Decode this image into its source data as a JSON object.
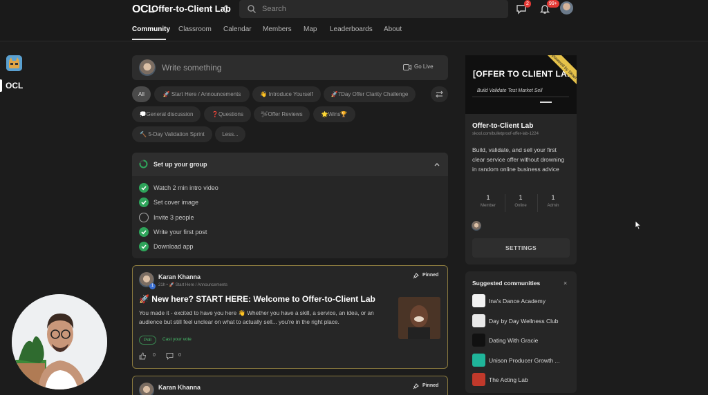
{
  "header": {
    "logo": "OCL",
    "group_name": "Offer-to-Client Lab",
    "search_placeholder": "Search",
    "chat_badge": "2",
    "notif_badge": "99+"
  },
  "nav": {
    "tabs": [
      "Community",
      "Classroom",
      "Calendar",
      "Members",
      "Map",
      "Leaderboards",
      "About"
    ]
  },
  "rail": {
    "ocl_label": "OCL"
  },
  "composer": {
    "placeholder": "Write something",
    "go_live": "Go Live"
  },
  "filters": {
    "chips": [
      "All",
      "🚀 Start Here / Announcements",
      "👋 Introduce Yourself",
      "🚀7Day Offer Clarity Challenge",
      "💭General discussion",
      "❓Questions",
      "🛩Offer Reviews",
      "🌟Wins🏆",
      "🔨 5-Day Validation Sprint",
      "Less..."
    ]
  },
  "setup": {
    "title": "Set up your group",
    "tasks": [
      {
        "label": "Watch 2 min intro video",
        "done": true
      },
      {
        "label": "Set cover image",
        "done": true
      },
      {
        "label": "Invite 3 people",
        "done": false
      },
      {
        "label": "Write your first post",
        "done": true
      },
      {
        "label": "Download app",
        "done": true
      }
    ]
  },
  "posts": [
    {
      "author": "Karan Khanna",
      "level": "1",
      "meta": "21h • 🚀 Start Here / Announcements",
      "pinned": "Pinned",
      "title": "🚀 New here? START HERE: Welcome to Offer-to-Client Lab",
      "body": "You made it - excited to have you here 👋 Whether you have a skill, a service, an idea, or an audience but still feel unclear on what to actually sell... you're in the right place.",
      "poll": "Poll",
      "cast_vote": "Cast your vote",
      "likes": "0",
      "comments": "0"
    },
    {
      "author": "Karan Khanna",
      "pinned": "Pinned"
    }
  ],
  "about": {
    "cover_title": "[OFFER TO CLIENT LAB]",
    "cover_subtitle": "Build Validate Test Market Sell",
    "ribbon": "powered by Skool",
    "name": "Offer-to-Client Lab",
    "url": "skool.com/bulletproof-offer-lab-1224",
    "description": "Build, validate, and sell your first clear service offer without drowning in random online business advice",
    "stats": [
      {
        "value": "1",
        "label": "Member"
      },
      {
        "value": "1",
        "label": "Online"
      },
      {
        "value": "1",
        "label": "Admin"
      }
    ],
    "settings": "SETTINGS"
  },
  "suggested": {
    "title": "Suggested communities",
    "close": "×",
    "items": [
      {
        "name": "Ina's Dance Academy",
        "color": "#f2f2f2"
      },
      {
        "name": "Day by Day Wellness Club",
        "color": "#e8e8e8"
      },
      {
        "name": "Dating With Gracie",
        "color": "#111111"
      },
      {
        "name": "Unison Producer Growth ...",
        "color": "#1fb59a"
      },
      {
        "name": "The Acting Lab",
        "color": "#c0392b"
      }
    ]
  },
  "colors": {
    "accent_green": "#2ea45a",
    "pinned_border": "#8a7a3e",
    "badge_red": "#e53935"
  }
}
